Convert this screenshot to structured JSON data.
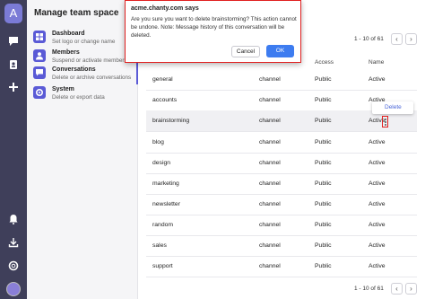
{
  "rail": {
    "logo_letter": "A",
    "icons": [
      "chat-icon",
      "contacts-icon",
      "add-icon",
      "bell-icon",
      "download-icon",
      "help-icon"
    ]
  },
  "sidebar": {
    "title": "Manage team space",
    "items": [
      {
        "label": "Dashboard",
        "sub": "Set logo or change name"
      },
      {
        "label": "Members",
        "sub": "Suspend or activate members"
      },
      {
        "label": "Conversations",
        "sub": "Delete or archive conversations"
      },
      {
        "label": "System",
        "sub": "Delete or export data"
      }
    ],
    "active_index": 2
  },
  "pager_top": {
    "text": "1 - 10 of 61",
    "prev": "‹",
    "next": "›"
  },
  "pager_bottom": {
    "text": "1 - 10 of 61",
    "prev": "‹",
    "next": "›"
  },
  "table": {
    "headers": [
      "Access",
      "Name"
    ],
    "rows": [
      {
        "name": "general",
        "type": "channel",
        "access": "Public",
        "status": "Active"
      },
      {
        "name": "accounts",
        "type": "channel",
        "access": "Public",
        "status": "Active"
      },
      {
        "name": "brainstorming",
        "type": "channel",
        "access": "Public",
        "status": "Active"
      },
      {
        "name": "blog",
        "type": "channel",
        "access": "Public",
        "status": "Active"
      },
      {
        "name": "design",
        "type": "channel",
        "access": "Public",
        "status": "Active"
      },
      {
        "name": "marketing",
        "type": "channel",
        "access": "Public",
        "status": "Active"
      },
      {
        "name": "newsletter",
        "type": "channel",
        "access": "Public",
        "status": "Active"
      },
      {
        "name": "random",
        "type": "channel",
        "access": "Public",
        "status": "Active"
      },
      {
        "name": "sales",
        "type": "channel",
        "access": "Public",
        "status": "Active"
      },
      {
        "name": "support",
        "type": "channel",
        "access": "Public",
        "status": "Active"
      }
    ]
  },
  "context_menu": {
    "delete_label": "Delete"
  },
  "dialog": {
    "title": "acme.chanty.com says",
    "message": "Are you sure you want to delete brainstorming? This action cannot be undone. Note: Message history of this conversation will be deleted.",
    "cancel_label": "Cancel",
    "ok_label": "OK"
  },
  "colors": {
    "accent": "#5a5ad6",
    "ok_button": "#3d7cf0",
    "highlight_border": "#e02020",
    "rail": "#3f3f5a"
  }
}
